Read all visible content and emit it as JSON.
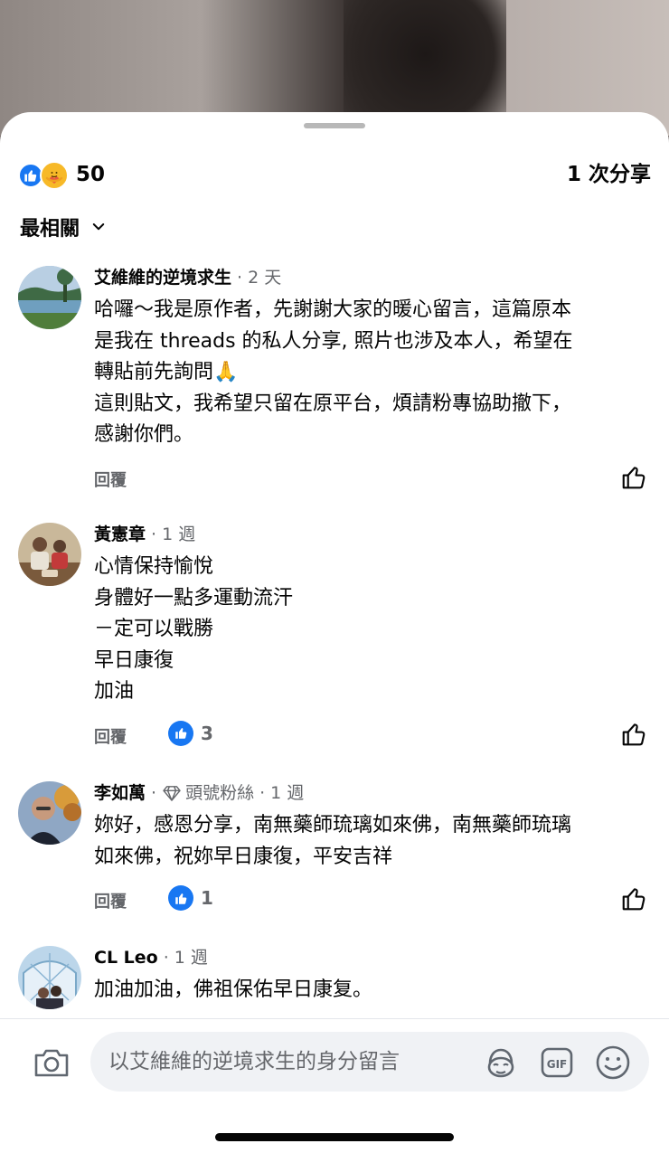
{
  "reactions": {
    "count": "50",
    "shares": "1 次分享",
    "icons": [
      "like-icon",
      "care-icon"
    ]
  },
  "sort": {
    "label": "最相關"
  },
  "comments": [
    {
      "name": "艾維維的逆境求生",
      "badge": "",
      "time": "2 天",
      "text": "哈囉～我是原作者，先謝謝大家的暖心留言，這篇原本\n是我在 threads 的私人分享, 照片也涉及本人，希望在\n轉貼前先詢問🙏\n這則貼文，我希望只留在原平台，煩請粉專協助撤下，\n感謝你們。",
      "reply": "回覆",
      "likes": ""
    },
    {
      "name": "黃憲章",
      "badge": "",
      "time": "1 週",
      "text": "心情保持愉悅\n身體好一點多運動流汗\n－定可以戰勝\n早日康復\n加油",
      "reply": "回覆",
      "likes": "3"
    },
    {
      "name": "李如萬",
      "badge": "頭號粉絲",
      "time": "1 週",
      "text": "妳好，感恩分享，南無藥師琉璃如來佛，南無藥師琉璃\n如來佛，祝妳早日康復，平安吉祥",
      "reply": "回覆",
      "likes": "1"
    },
    {
      "name": "CL Leo",
      "badge": "",
      "time": "1 週",
      "text": "加油加油，佛祖保佑早日康复。",
      "reply": "回覆",
      "likes": ""
    }
  ],
  "composer": {
    "placeholder": "以艾維維的逆境求生的身分留言"
  },
  "colors": {
    "accent": "#1877f2",
    "muted": "#65676b",
    "care": "#f7b928"
  }
}
